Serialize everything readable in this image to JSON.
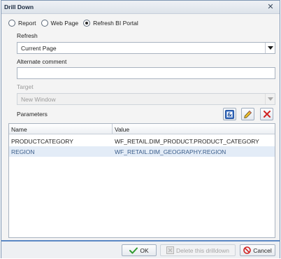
{
  "window": {
    "title": "Drill Down"
  },
  "target_type": {
    "options": [
      {
        "label": "Report",
        "checked": false
      },
      {
        "label": "Web Page",
        "checked": false
      },
      {
        "label": "Refresh BI Portal",
        "checked": true
      }
    ]
  },
  "refresh": {
    "label": "Refresh",
    "value": "Current Page"
  },
  "alternate_comment": {
    "label": "Alternate comment",
    "value": ""
  },
  "target": {
    "label": "Target",
    "value": "New Window",
    "disabled": true
  },
  "parameters": {
    "label": "Parameters",
    "columns": {
      "name": "Name",
      "value": "Value"
    },
    "rows": [
      {
        "name": "PRODUCTCATEGORY",
        "value": "WF_RETAIL.DIM_PRODUCT.PRODUCT_CATEGORY",
        "selected": false
      },
      {
        "name": "REGION",
        "value": "WF_RETAIL.DIM_GEOGRAPHY.REGION",
        "selected": true
      }
    ]
  },
  "buttons": {
    "ok": "OK",
    "delete": "Delete this drilldown",
    "cancel": "Cancel"
  },
  "colors": {
    "accent": "#5b87c4",
    "selected_row": "#e3ecf7",
    "delete_red": "#d02020"
  }
}
